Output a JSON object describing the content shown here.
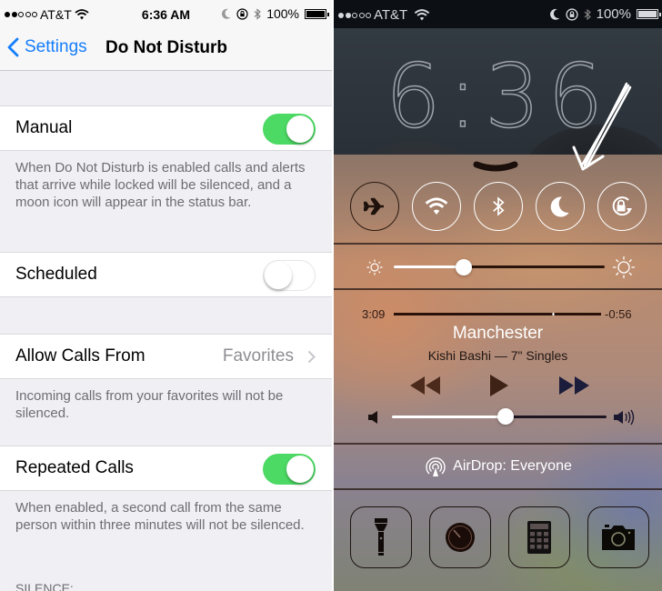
{
  "settings": {
    "status_bar": {
      "carrier": "AT&T",
      "signal_bars_filled": 2,
      "signal_bars_total": 5,
      "time": "6:36 AM",
      "battery": "100%",
      "icons": [
        "wifi-icon",
        "moon-icon",
        "rotation-lock-icon",
        "bluetooth-icon",
        "battery-icon"
      ]
    },
    "nav": {
      "back_label": "Settings",
      "title": "Do Not Disturb"
    },
    "manual": {
      "label": "Manual",
      "enabled": true,
      "footer": "When Do Not Disturb is enabled calls and alerts that arrive while locked will be silenced, and a moon icon will appear in the status bar."
    },
    "scheduled": {
      "label": "Scheduled",
      "enabled": false
    },
    "allow_calls": {
      "label": "Allow Calls From",
      "value": "Favorites",
      "footer": "Incoming calls from your favorites will not be silenced."
    },
    "repeated_calls": {
      "label": "Repeated Calls",
      "enabled": true,
      "footer": "When enabled, a second call from the same person within three minutes will not be silenced."
    },
    "silence_header": "SILENCE:"
  },
  "control_center": {
    "status_bar": {
      "carrier": "AT&T",
      "signal_bars_filled": 2,
      "signal_bars_total": 5,
      "battery": "100%"
    },
    "lock_time": "6:36",
    "toggles": [
      {
        "name": "airplane-mode",
        "icon": "airplane-icon",
        "active": false
      },
      {
        "name": "wifi",
        "icon": "wifi-icon",
        "active": true
      },
      {
        "name": "bluetooth",
        "icon": "bluetooth-icon",
        "active": true
      },
      {
        "name": "do-not-disturb",
        "icon": "moon-icon",
        "active": true
      },
      {
        "name": "rotation-lock",
        "icon": "rotation-lock-icon",
        "active": true
      }
    ],
    "brightness_fraction": 0.33,
    "music": {
      "elapsed": "3:09",
      "remaining": "-0:56",
      "progress_fraction": 0.77,
      "title": "Manchester",
      "artist_album": "Kishi Bashi — 7\" Singles"
    },
    "volume_fraction": 0.53,
    "airdrop_label": "AirDrop: Everyone",
    "shortcuts": [
      {
        "name": "flashlight",
        "icon": "flashlight-icon"
      },
      {
        "name": "timer",
        "icon": "timer-icon"
      },
      {
        "name": "calculator",
        "icon": "calculator-icon"
      },
      {
        "name": "camera",
        "icon": "camera-icon"
      }
    ],
    "colors": {
      "switch_on": "#4cd964",
      "ios_blue": "#157efb"
    }
  }
}
